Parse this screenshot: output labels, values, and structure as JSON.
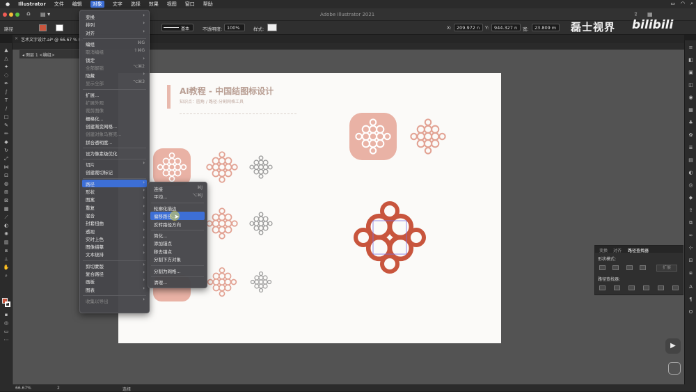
{
  "menubar": {
    "apple": "",
    "items": [
      "Illustrator",
      "文件",
      "编辑",
      "对象",
      "文字",
      "选择",
      "效果",
      "视图",
      "窗口",
      "帮助"
    ],
    "active_index": 3
  },
  "window_title": "Adobe Illustrator 2021",
  "control": {
    "path_label": "路径",
    "stroke_profile": "基本",
    "opacity_label": "不透明度:",
    "opacity_value": "100%",
    "style_label": "样式:",
    "x_label": "X:",
    "x_value": "209.972 n",
    "y_label": "Y:",
    "y_value": "944.327 n",
    "w_label": "宽:",
    "w_value": "23.809 m"
  },
  "doc_tab": "艺术文字设计.ai* @ 66.67 % (R",
  "layer_breadcrumb": [
    "图层 1",
    "<编组>"
  ],
  "artboard": {
    "title": "AI教程 - 中国结图标设计",
    "subtitle": "知识点：圆角 / 路径-分割网格工具"
  },
  "object_menu": {
    "items": [
      {
        "label": "变换",
        "arrow": true
      },
      {
        "label": "排列",
        "arrow": true
      },
      {
        "label": "对齐",
        "arrow": true
      },
      {
        "sep": true
      },
      {
        "label": "编组",
        "shortcut": "⌘G"
      },
      {
        "label": "取消编组",
        "shortcut": "⇧⌘G",
        "disabled": true
      },
      {
        "label": "锁定",
        "arrow": true
      },
      {
        "label": "全部解锁",
        "shortcut": "⌥⌘2",
        "disabled": true
      },
      {
        "label": "隐藏",
        "arrow": true
      },
      {
        "label": "显示全部",
        "shortcut": "⌥⌘3",
        "disabled": true
      },
      {
        "sep": true
      },
      {
        "label": "扩展..."
      },
      {
        "label": "扩展外观",
        "disabled": true
      },
      {
        "label": "裁剪图像",
        "disabled": true
      },
      {
        "label": "栅格化..."
      },
      {
        "label": "创建渐变网格..."
      },
      {
        "label": "创建对象马赛克...",
        "disabled": true
      },
      {
        "label": "拼合透明度..."
      },
      {
        "sep": true
      },
      {
        "label": "设为像素级优化"
      },
      {
        "sep": true
      },
      {
        "label": "切片",
        "arrow": true
      },
      {
        "label": "创建裁切标记"
      },
      {
        "sep": true
      },
      {
        "label": "路径",
        "arrow": true,
        "highlight": true
      },
      {
        "label": "形状",
        "arrow": true
      },
      {
        "label": "图案",
        "arrow": true
      },
      {
        "label": "重复",
        "arrow": true
      },
      {
        "label": "混合",
        "arrow": true
      },
      {
        "label": "封套扭曲",
        "arrow": true
      },
      {
        "label": "透视",
        "arrow": true
      },
      {
        "label": "实时上色",
        "arrow": true
      },
      {
        "label": "图像描摹",
        "arrow": true
      },
      {
        "label": "文本绕排",
        "arrow": true
      },
      {
        "sep": true
      },
      {
        "label": "剪切蒙版",
        "arrow": true
      },
      {
        "label": "复合路径",
        "arrow": true
      },
      {
        "label": "画板",
        "arrow": true
      },
      {
        "label": "图表",
        "arrow": true
      },
      {
        "sep": true
      },
      {
        "label": "收集以导出",
        "arrow": true,
        "disabled": true
      }
    ]
  },
  "path_submenu": {
    "items": [
      {
        "label": "连接",
        "shortcut": "⌘J"
      },
      {
        "label": "平均...",
        "shortcut": "⌥⌘J"
      },
      {
        "sep": true
      },
      {
        "label": "轮廓化描边"
      },
      {
        "label": "偏移路径...",
        "highlight": true
      },
      {
        "label": "反转路径方向"
      },
      {
        "sep": true
      },
      {
        "label": "简化..."
      },
      {
        "label": "添加锚点"
      },
      {
        "label": "移去锚点"
      },
      {
        "label": "分割下方对象"
      },
      {
        "sep": true
      },
      {
        "label": "分割为网格..."
      },
      {
        "sep": true
      },
      {
        "label": "清理..."
      }
    ]
  },
  "pathfinder": {
    "tabs": [
      "变换",
      "对齐",
      "路径查找器"
    ],
    "shape_modes_label": "形状模式:",
    "expand_label": "扩展",
    "pathfinders_label": "路径查找器:"
  },
  "status": {
    "zoom": "66.67%",
    "page": "2",
    "tool": "选择"
  },
  "watermark": {
    "left": "磊士视界",
    "right": "bilibili"
  },
  "colors": {
    "accent": "#3d6fd6",
    "knot_red": "#c8553d",
    "knot_pink": "#e2a293",
    "knot_gray": "#9a9a9a",
    "rounded_bg": "#e9b2a5",
    "title_color": "#b99f94"
  }
}
